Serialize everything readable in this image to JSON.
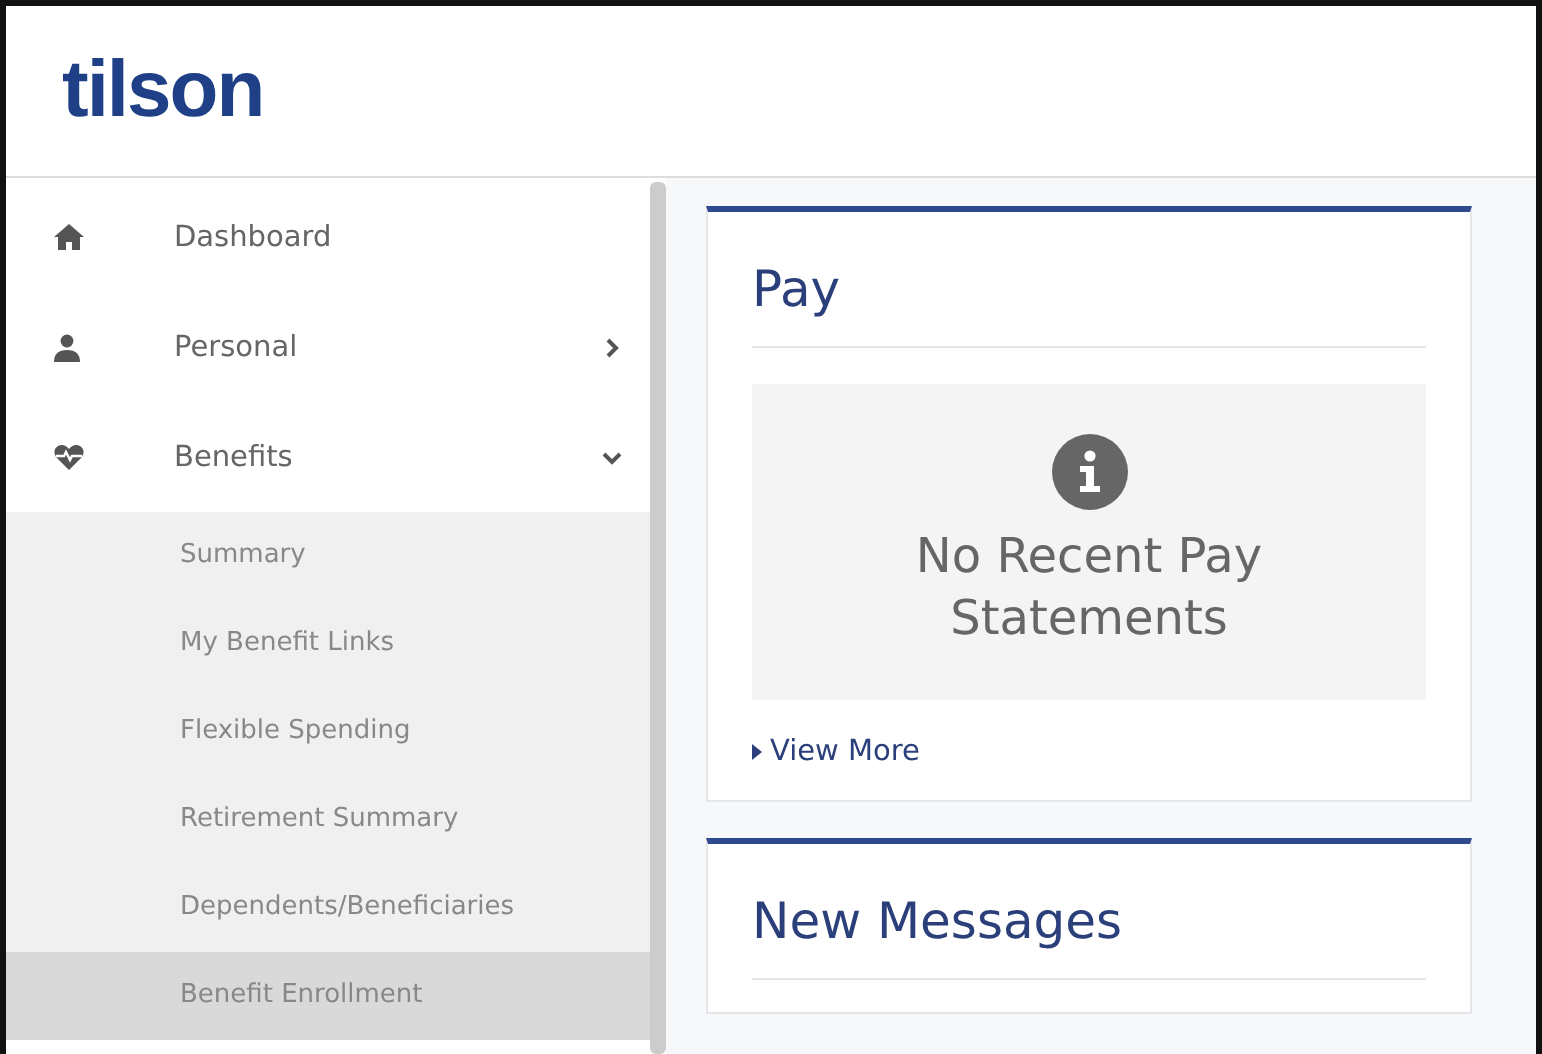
{
  "header": {
    "logo": "tilson"
  },
  "sidebar": {
    "items": [
      {
        "label": "Dashboard"
      },
      {
        "label": "Personal",
        "expanded": false
      },
      {
        "label": "Benefits",
        "expanded": true,
        "children": [
          {
            "label": "Summary",
            "selected": false
          },
          {
            "label": "My Benefit Links",
            "selected": false
          },
          {
            "label": "Flexible Spending",
            "selected": false
          },
          {
            "label": "Retirement Summary",
            "selected": false
          },
          {
            "label": "Dependents/Beneficiaries",
            "selected": false
          },
          {
            "label": "Benefit Enrollment",
            "selected": true
          }
        ]
      }
    ]
  },
  "cards": [
    {
      "title": "Pay",
      "empty_message": "No Recent Pay Statements",
      "link": "View More"
    },
    {
      "title": "New Messages"
    }
  ]
}
